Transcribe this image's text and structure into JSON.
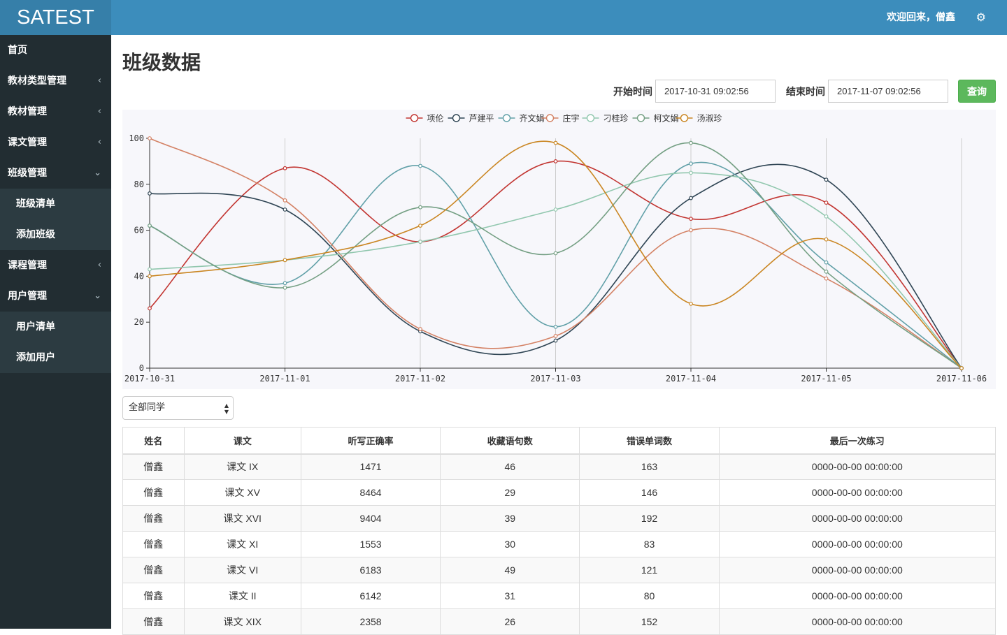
{
  "app": {
    "logo": "SATEST",
    "welcome": "欢迎回来，僧鑫",
    "gear_icon": "gear-icon"
  },
  "sidebar": {
    "items": [
      {
        "label": "首页",
        "chevron": ""
      },
      {
        "label": "教材类型管理",
        "chevron": "‹"
      },
      {
        "label": "教材管理",
        "chevron": "‹"
      },
      {
        "label": "课文管理",
        "chevron": "‹"
      },
      {
        "label": "班级管理",
        "chevron": "⌄"
      },
      {
        "label": "班级清单"
      },
      {
        "label": "添加班级"
      },
      {
        "label": "课程管理",
        "chevron": "‹"
      },
      {
        "label": "用户管理",
        "chevron": "⌄"
      },
      {
        "label": "用户清单"
      },
      {
        "label": "添加用户"
      }
    ]
  },
  "page": {
    "title": "班级数据",
    "start_label": "开始时间",
    "start_value": "2017-10-31 09:02:56",
    "end_label": "结束时间",
    "end_value": "2017-11-07 09:02:56",
    "query_label": "查询",
    "student_select": "全部同学"
  },
  "chart_data": {
    "type": "line",
    "categories": [
      "2017-10-31",
      "2017-11-01",
      "2017-11-02",
      "2017-11-03",
      "2017-11-04",
      "2017-11-05",
      "2017-11-06"
    ],
    "ylim": [
      0,
      100
    ],
    "yticks": [
      0,
      20,
      40,
      60,
      80,
      100
    ],
    "smooth": true,
    "legend_position": "top-center",
    "series": [
      {
        "name": "项伦",
        "color": "#c23531",
        "values": [
          26,
          87,
          55,
          90,
          65,
          72,
          0
        ]
      },
      {
        "name": "芦建平",
        "color": "#2f4554",
        "values": [
          76,
          69,
          16,
          12,
          74,
          82,
          0
        ]
      },
      {
        "name": "齐文娟",
        "color": "#61a0a8",
        "values": [
          62,
          37,
          88,
          18,
          89,
          46,
          0
        ]
      },
      {
        "name": "庄宇",
        "color": "#d48265",
        "values": [
          100,
          73,
          17,
          14,
          60,
          39,
          0
        ]
      },
      {
        "name": "刁桂珍",
        "color": "#91c7ae",
        "values": [
          43,
          47,
          55,
          69,
          85,
          66,
          0
        ]
      },
      {
        "name": "柯文娟",
        "color": "#749f83",
        "values": [
          62,
          35,
          70,
          50,
          98,
          42,
          0
        ]
      },
      {
        "name": "汤淑珍",
        "color": "#ca8622",
        "values": [
          40,
          47,
          62,
          98,
          28,
          56,
          0
        ]
      }
    ]
  },
  "table": {
    "headers": [
      "姓名",
      "课文",
      "听写正确率",
      "收藏语句数",
      "错误单词数",
      "最后一次练习"
    ],
    "rows": [
      [
        "僧鑫",
        "课文 IX",
        "1471",
        "46",
        "163",
        "0000-00-00 00:00:00"
      ],
      [
        "僧鑫",
        "课文 XV",
        "8464",
        "29",
        "146",
        "0000-00-00 00:00:00"
      ],
      [
        "僧鑫",
        "课文 XVI",
        "9404",
        "39",
        "192",
        "0000-00-00 00:00:00"
      ],
      [
        "僧鑫",
        "课文 XI",
        "1553",
        "30",
        "83",
        "0000-00-00 00:00:00"
      ],
      [
        "僧鑫",
        "课文 VI",
        "6183",
        "49",
        "121",
        "0000-00-00 00:00:00"
      ],
      [
        "僧鑫",
        "课文 II",
        "6142",
        "31",
        "80",
        "0000-00-00 00:00:00"
      ],
      [
        "僧鑫",
        "课文 XIX",
        "2358",
        "26",
        "152",
        "0000-00-00 00:00:00"
      ]
    ]
  }
}
